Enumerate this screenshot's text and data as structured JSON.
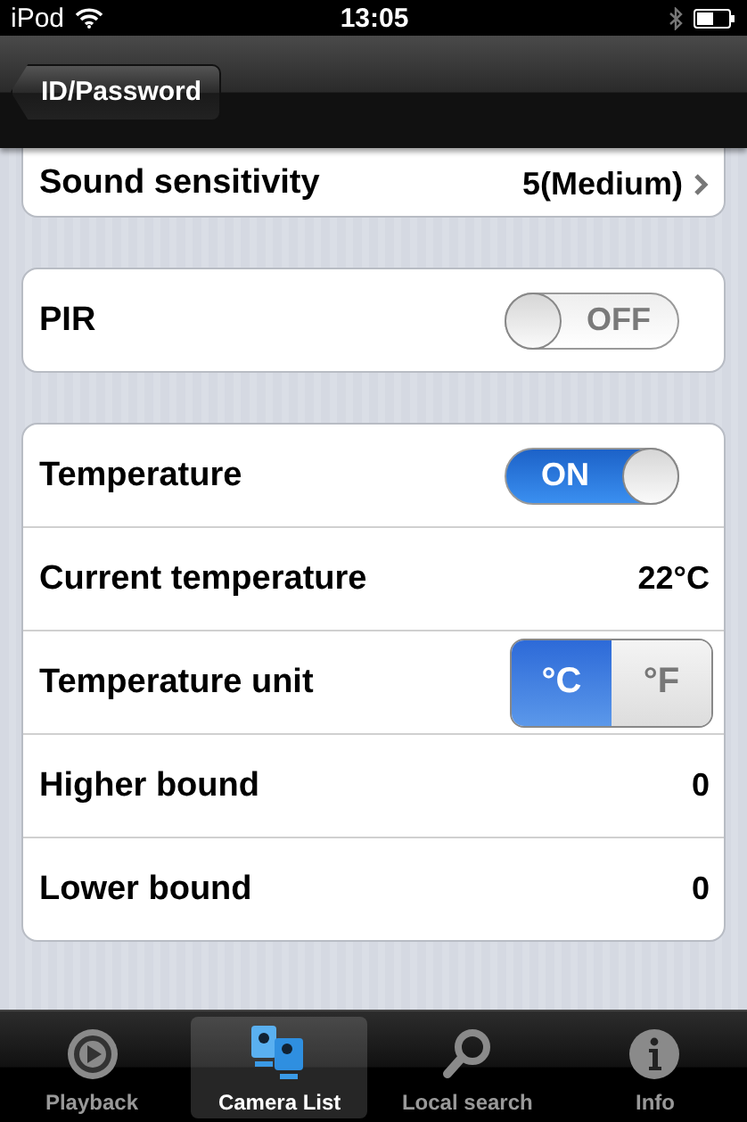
{
  "status_bar": {
    "device": "iPod",
    "time": "13:05"
  },
  "nav_bar": {
    "back": "ID/Password"
  },
  "sections": [
    {
      "rows": [
        {
          "kind": "link",
          "label": "Sound sensitivity",
          "value": "5(Medium)"
        }
      ]
    },
    {
      "rows": [
        {
          "kind": "toggle",
          "label": "PIR",
          "on": false,
          "switch_text": "OFF"
        }
      ]
    },
    {
      "rows": [
        {
          "kind": "toggle",
          "label": "Temperature",
          "on": true,
          "switch_text": "ON"
        },
        {
          "kind": "value",
          "label": "Current temperature",
          "value": "22°C"
        },
        {
          "kind": "segmented",
          "label": "Temperature unit",
          "options": [
            {
              "label": "°C",
              "selected": true
            },
            {
              "label": "°F",
              "selected": false
            }
          ]
        },
        {
          "kind": "value",
          "label": "Higher bound",
          "value": "0"
        },
        {
          "kind": "value",
          "label": "Lower bound",
          "value": "0"
        }
      ]
    }
  ],
  "tabs": [
    {
      "label": "Playback",
      "kind": "playback",
      "selected": false
    },
    {
      "label": "Camera List",
      "kind": "cameras",
      "selected": true
    },
    {
      "label": "Local search",
      "kind": "search",
      "selected": false
    },
    {
      "label": "Info",
      "kind": "info",
      "selected": false
    }
  ]
}
